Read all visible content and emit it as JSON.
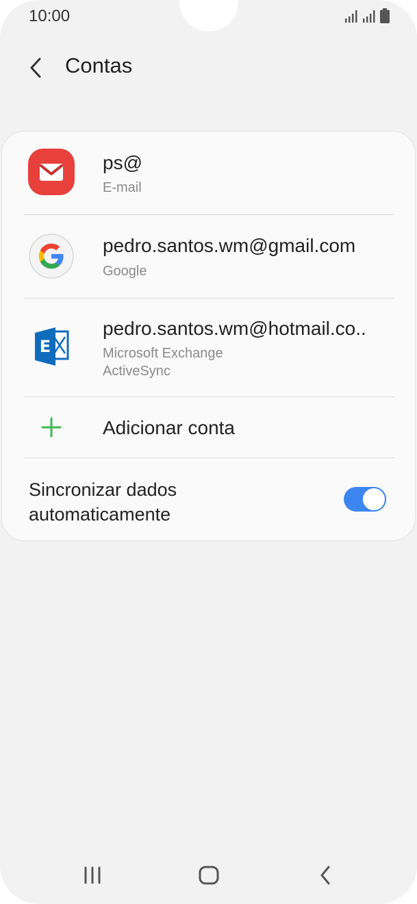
{
  "status_bar": {
    "time": "10:00",
    "icons": [
      "signal-icon",
      "signal-icon",
      "battery-icon"
    ]
  },
  "header": {
    "title": "Contas",
    "back_icon": "chevron-left-icon"
  },
  "accounts": [
    {
      "name": "ps@",
      "type": "E-mail",
      "icon": "email-app-icon"
    },
    {
      "name": "pedro.santos.wm@gmail.com",
      "type": "Google",
      "icon": "google-icon"
    },
    {
      "name": "pedro.santos.wm@hotmail.co..",
      "type_line1": "Microsoft Exchange",
      "type_line2": "ActiveSync",
      "icon": "exchange-icon"
    }
  ],
  "add_account": {
    "label": "Adicionar conta",
    "icon": "plus-icon"
  },
  "sync": {
    "label_line1": "Sincronizar dados",
    "label_line2": "automaticamente",
    "enabled": true
  },
  "navigation": {
    "recents_icon": "recents-icon",
    "home_icon": "home-icon",
    "back_icon": "back-icon"
  },
  "colors": {
    "accent": "#3d86f0",
    "email_red": "#e8413c",
    "exchange_blue": "#0f6cbd",
    "add_green": "#3cba4f"
  }
}
